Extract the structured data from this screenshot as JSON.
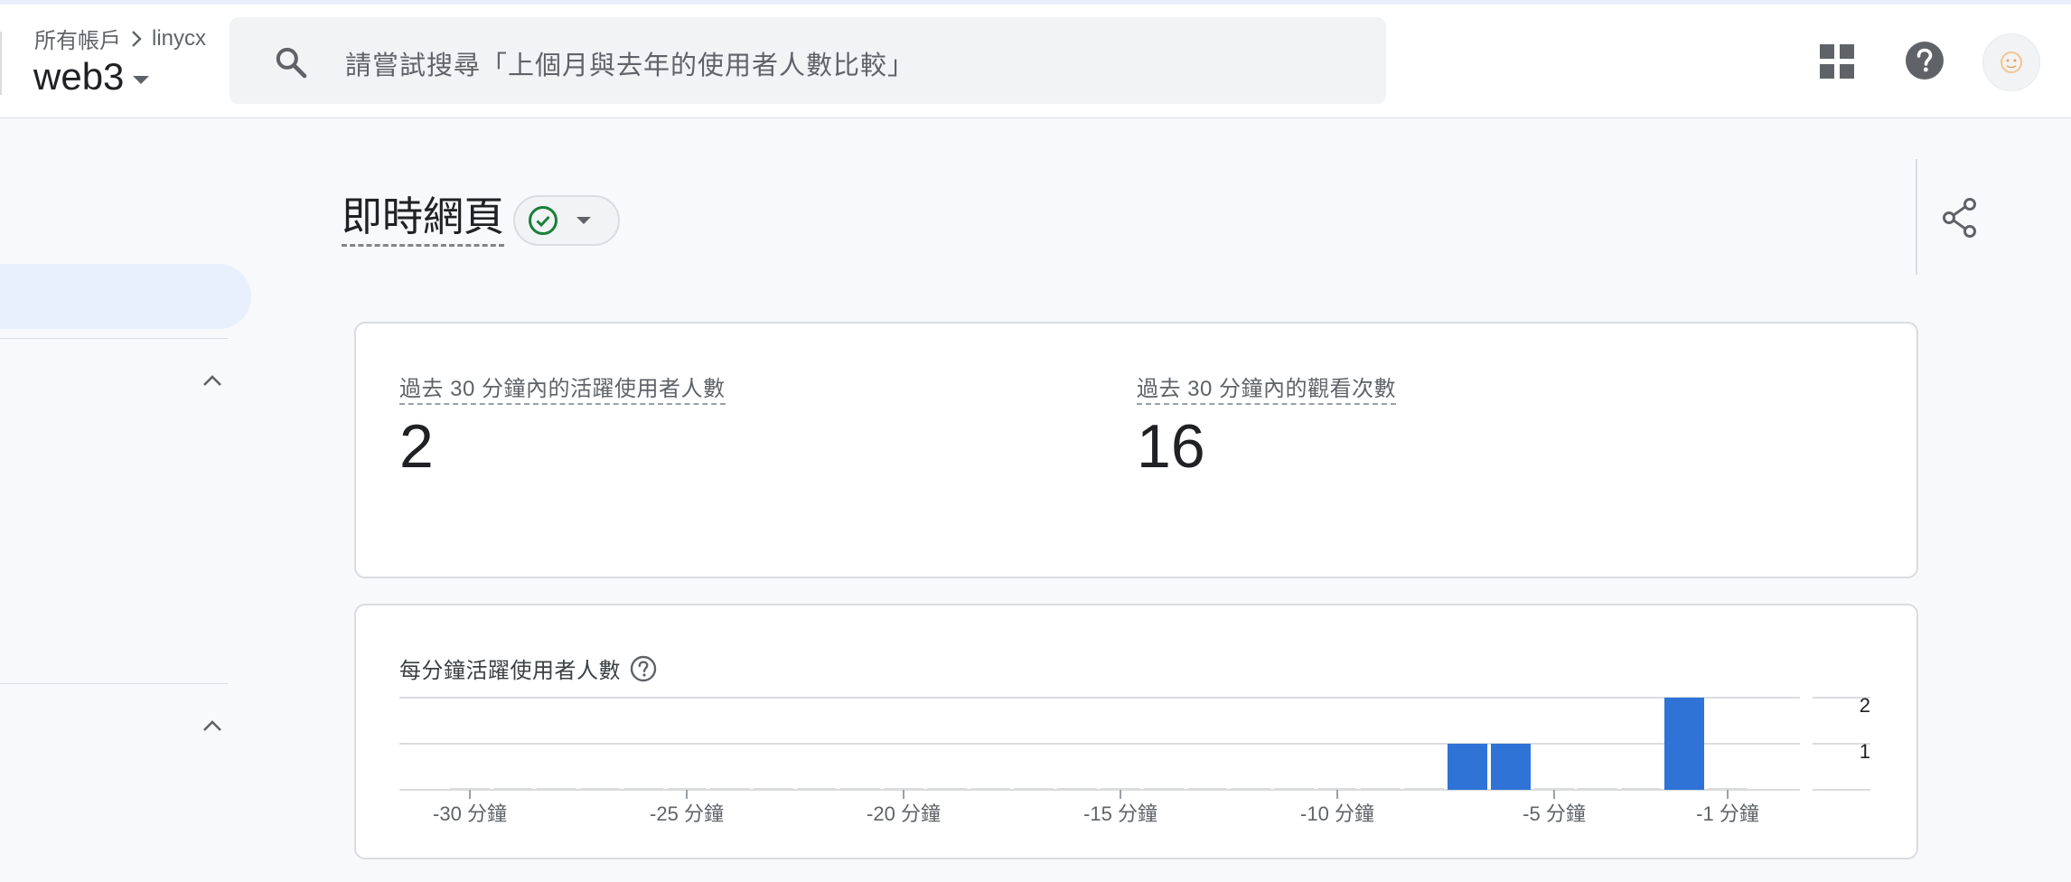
{
  "breadcrumb": {
    "all_accounts": "所有帳戶",
    "account": "linycx"
  },
  "property": {
    "name": "web3"
  },
  "search": {
    "placeholder": "請嘗試搜尋「上個月與去年的使用者人數比較」"
  },
  "colors": {
    "accent_blue": "#2f73d6",
    "check_green": "#188038",
    "selected_nav": "#e8f0fe"
  },
  "page": {
    "title": "即時網頁"
  },
  "metrics": [
    {
      "label": "過去 30 分鐘內的活躍使用者人數",
      "value": "2"
    },
    {
      "label": "過去 30 分鐘內的觀看次數",
      "value": "16"
    }
  ],
  "chart_data": {
    "type": "bar",
    "title": "每分鐘活躍使用者人數",
    "categories": [
      -30,
      -29,
      -28,
      -27,
      -26,
      -25,
      -24,
      -23,
      -22,
      -21,
      -20,
      -19,
      -18,
      -17,
      -16,
      -15,
      -14,
      -13,
      -12,
      -11,
      -10,
      -9,
      -8,
      -7,
      -6,
      -5,
      -4,
      -3,
      -2,
      -1
    ],
    "values": [
      0,
      0,
      0,
      0,
      0,
      0,
      0,
      0,
      0,
      0,
      0,
      0,
      0,
      0,
      0,
      0,
      0,
      0,
      0,
      0,
      0,
      0,
      0,
      1,
      1,
      0,
      0,
      0,
      2,
      0
    ],
    "x_tick_labels": [
      "-30 分鐘",
      "-25 分鐘",
      "-20 分鐘",
      "-15 分鐘",
      "-10 分鐘",
      "-5 分鐘",
      "-1 分鐘"
    ],
    "x_tick_minutes": [
      -30,
      -25,
      -20,
      -15,
      -10,
      -5,
      -1
    ],
    "y_tick_labels": [
      "2",
      "1"
    ],
    "y_tick_values": [
      2,
      1
    ],
    "ylim": [
      0,
      2
    ],
    "grid": true,
    "y_axis_position": "right"
  }
}
